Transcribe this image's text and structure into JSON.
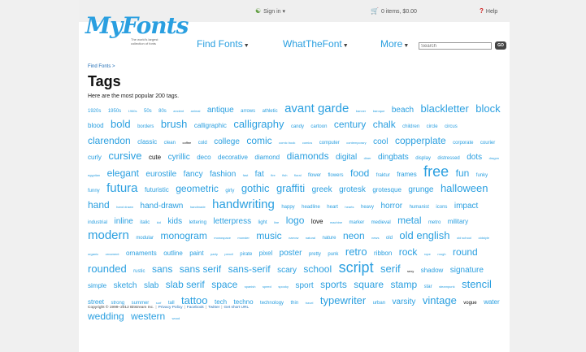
{
  "utility": {
    "sign_in": "Sign in",
    "cart": "0 items, $0.00",
    "help": "Help"
  },
  "logo": {
    "text": "MyFonts",
    "tagline": "The world's largest\ncollection of fonts"
  },
  "nav": {
    "find_fonts": "Find Fonts",
    "what_the_font": "WhatTheFont",
    "more": "More",
    "search_placeholder": "Search",
    "go": "GO"
  },
  "breadcrumb": "Find Fonts >",
  "title": "Tags",
  "subtitle": "Here are the most popular 200 tags.",
  "tags": [
    [
      "1920s",
      2
    ],
    [
      "1950s",
      2
    ],
    [
      "1960s",
      1
    ],
    [
      "50s",
      2
    ],
    [
      "80s",
      2
    ],
    [
      "ancient",
      1
    ],
    [
      "animal",
      1
    ],
    [
      "antique",
      4
    ],
    [
      "arrows",
      2
    ],
    [
      "athletic",
      2
    ],
    [
      "avant garde",
      7
    ],
    [
      "banner",
      1
    ],
    [
      "baroque",
      1
    ],
    [
      "beach",
      4
    ],
    [
      "blackletter",
      6
    ],
    [
      "block",
      6
    ],
    [
      "blood",
      3
    ],
    [
      "bold",
      6
    ],
    [
      "borders",
      2
    ],
    [
      "brush",
      6
    ],
    [
      "calligraphic",
      3
    ],
    [
      "calligraphy",
      6
    ],
    [
      "candy",
      2
    ],
    [
      "cartoon",
      2
    ],
    [
      "century",
      5
    ],
    [
      "chalk",
      5
    ],
    [
      "children",
      2
    ],
    [
      "circle",
      2
    ],
    [
      "circus",
      2
    ],
    [
      "clarendon",
      5
    ],
    [
      "classic",
      3
    ],
    [
      "clean",
      2
    ],
    [
      "coffee",
      1,
      "dark"
    ],
    [
      "cold",
      2
    ],
    [
      "college",
      4
    ],
    [
      "comic",
      5
    ],
    [
      "comic book",
      1
    ],
    [
      "comics",
      1
    ],
    [
      "computer",
      2
    ],
    [
      "contemporary",
      1
    ],
    [
      "cool",
      4
    ],
    [
      "copperplate",
      5
    ],
    [
      "corporate",
      2
    ],
    [
      "courier",
      2
    ],
    [
      "curly",
      3
    ],
    [
      "cursive",
      6
    ],
    [
      "cute",
      3,
      "dark"
    ],
    [
      "cyrillic",
      4
    ],
    [
      "deco",
      3
    ],
    [
      "decorative",
      3
    ],
    [
      "diamond",
      3
    ],
    [
      "diamonds",
      5
    ],
    [
      "digital",
      4
    ],
    [
      "diner",
      1
    ],
    [
      "dingbats",
      4
    ],
    [
      "display",
      2
    ],
    [
      "distressed",
      2
    ],
    [
      "dots",
      4
    ],
    [
      "dragon",
      1
    ],
    [
      "egyptian",
      1
    ],
    [
      "elegant",
      5
    ],
    [
      "eurostile",
      4
    ],
    [
      "fancy",
      4
    ],
    [
      "fashion",
      4
    ],
    [
      "fast",
      1
    ],
    [
      "fat",
      4
    ],
    [
      "fire",
      1
    ],
    [
      "fish",
      1
    ],
    [
      "floral",
      1
    ],
    [
      "flower",
      2
    ],
    [
      "flowers",
      2
    ],
    [
      "food",
      5
    ],
    [
      "fraktur",
      2
    ],
    [
      "frames",
      3
    ],
    [
      "free",
      8
    ],
    [
      "fun",
      5
    ],
    [
      "funky",
      2
    ],
    [
      "funny",
      2
    ],
    [
      "futura",
      7
    ],
    [
      "futuristic",
      3
    ],
    [
      "geometric",
      5
    ],
    [
      "girly",
      2
    ],
    [
      "gothic",
      6
    ],
    [
      "graffiti",
      6
    ],
    [
      "greek",
      4
    ],
    [
      "grotesk",
      4
    ],
    [
      "grotesque",
      3
    ],
    [
      "grunge",
      4
    ],
    [
      "halloween",
      6
    ],
    [
      "hand",
      5
    ],
    [
      "hand drawn",
      1
    ],
    [
      "hand-drawn",
      4
    ],
    [
      "handmade",
      1
    ],
    [
      "handwriting",
      7
    ],
    [
      "happy",
      2
    ],
    [
      "headline",
      2
    ],
    [
      "heart",
      2
    ],
    [
      "hearts",
      1
    ],
    [
      "heavy",
      2
    ],
    [
      "horror",
      4
    ],
    [
      "humanist",
      2
    ],
    [
      "icons",
      2
    ],
    [
      "impact",
      4
    ],
    [
      "industrial",
      2
    ],
    [
      "inline",
      4
    ],
    [
      "italic",
      2
    ],
    [
      "kid",
      1
    ],
    [
      "kids",
      4
    ],
    [
      "lettering",
      2
    ],
    [
      "letterpress",
      4
    ],
    [
      "light",
      2
    ],
    [
      "line",
      1
    ],
    [
      "logo",
      5
    ],
    [
      "love",
      3,
      "dark"
    ],
    [
      "machine",
      1
    ],
    [
      "marker",
      2
    ],
    [
      "medieval",
      2
    ],
    [
      "metal",
      5
    ],
    [
      "metro",
      2
    ],
    [
      "military",
      3
    ],
    [
      "modern",
      7
    ],
    [
      "modular",
      2
    ],
    [
      "monogram",
      5
    ],
    [
      "monospace",
      1
    ],
    [
      "monster",
      1
    ],
    [
      "music",
      5
    ],
    [
      "narrow",
      1
    ],
    [
      "natural",
      1
    ],
    [
      "nature",
      2
    ],
    [
      "neon",
      5
    ],
    [
      "news",
      1
    ],
    [
      "old",
      2
    ],
    [
      "old english",
      6
    ],
    [
      "old school",
      1
    ],
    [
      "oldstyle",
      1
    ],
    [
      "organic",
      1
    ],
    [
      "ornament",
      1
    ],
    [
      "ornaments",
      3
    ],
    [
      "outline",
      3
    ],
    [
      "paint",
      3
    ],
    [
      "party",
      1
    ],
    [
      "pencil",
      1
    ],
    [
      "pirate",
      2
    ],
    [
      "pixel",
      3
    ],
    [
      "poster",
      4
    ],
    [
      "pretty",
      2
    ],
    [
      "punk",
      2
    ],
    [
      "retro",
      6
    ],
    [
      "ribbon",
      3
    ],
    [
      "rock",
      5
    ],
    [
      "rope",
      1
    ],
    [
      "rough",
      1
    ],
    [
      "round",
      5
    ],
    [
      "rounded",
      6
    ],
    [
      "rustic",
      2
    ],
    [
      "sans",
      5
    ],
    [
      "sans serif",
      5
    ],
    [
      "sans-serif",
      5
    ],
    [
      "scary",
      4
    ],
    [
      "school",
      5
    ],
    [
      "script",
      8
    ],
    [
      "serif",
      6
    ],
    [
      "sexy",
      1,
      "dark"
    ],
    [
      "shadow",
      3
    ],
    [
      "signature",
      4
    ],
    [
      "simple",
      3
    ],
    [
      "sketch",
      4
    ],
    [
      "slab",
      4
    ],
    [
      "slab serif",
      5
    ],
    [
      "space",
      5
    ],
    [
      "spanish",
      1
    ],
    [
      "speed",
      1
    ],
    [
      "spooky",
      1
    ],
    [
      "sport",
      4
    ],
    [
      "sports",
      5
    ],
    [
      "square",
      5
    ],
    [
      "stamp",
      5
    ],
    [
      "star",
      2
    ],
    [
      "steampunk",
      1
    ],
    [
      "stencil",
      6
    ],
    [
      "street",
      3
    ],
    [
      "strong",
      2
    ],
    [
      "summer",
      2
    ],
    [
      "surf",
      1
    ],
    [
      "tall",
      2
    ],
    [
      "tattoo",
      6
    ],
    [
      "tech",
      3
    ],
    [
      "techno",
      3
    ],
    [
      "technology",
      2
    ],
    [
      "thin",
      2
    ],
    [
      "travel",
      1
    ],
    [
      "typewriter",
      6
    ],
    [
      "urban",
      2
    ],
    [
      "varsity",
      4
    ],
    [
      "vintage",
      6
    ],
    [
      "vogue",
      2,
      "dark"
    ],
    [
      "water",
      3
    ],
    [
      "wedding",
      5
    ],
    [
      "western",
      5
    ],
    [
      "wood",
      1
    ]
  ],
  "footer": {
    "copyright": "Copyright © 1999–2012 Bitstream Inc.",
    "privacy": "Privacy Policy",
    "facebook": "Facebook",
    "twitter": "Twitter",
    "short_url": "Get short URL"
  },
  "colors": {
    "accent": "#2a9fe0",
    "link": "#1f6db5",
    "text": "#111111"
  }
}
